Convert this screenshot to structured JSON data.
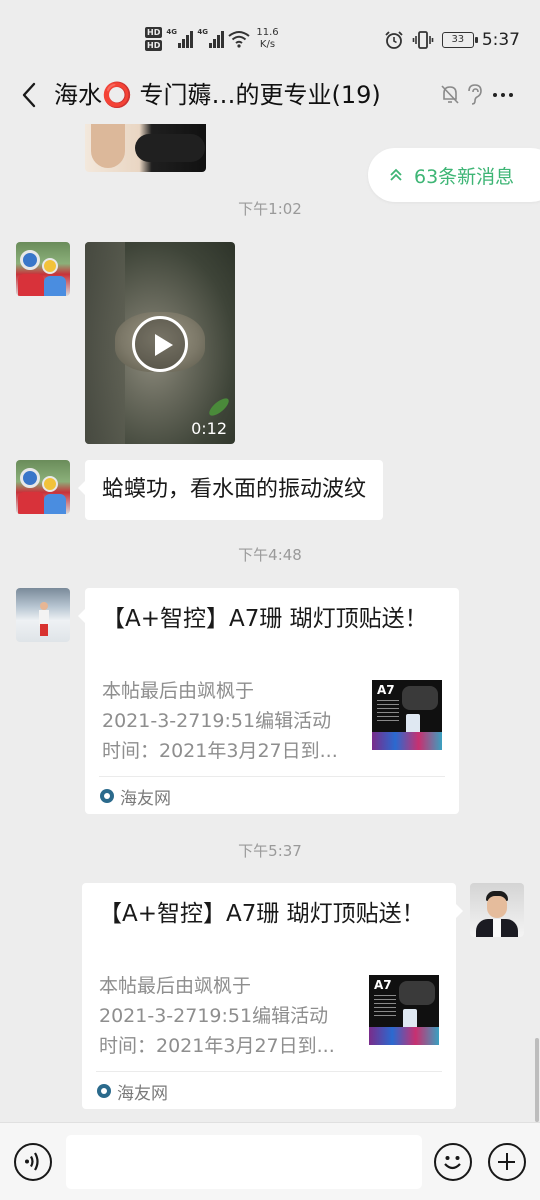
{
  "status_bar": {
    "hd_top": "HD",
    "hd_bottom": "HD",
    "net1": "4G",
    "net2": "4G",
    "speed_value": "11.6",
    "speed_unit": "K/s",
    "battery": "33",
    "time": "5:37"
  },
  "header": {
    "title": "海水⭕ 专门薅…的更专业(19)"
  },
  "new_messages": {
    "label": "63条新消息",
    "accent": "#3eb575"
  },
  "messages": {
    "ts1": "下午1:02",
    "video_duration": "0:12",
    "text1": "蛤蟆功，看水面的振动波纹",
    "ts2": "下午4:48",
    "card1": {
      "title": "【A+智控】A7珊 瑚灯顶贴送！",
      "desc1": "本帖最后由飒枫于",
      "desc2": "2021-3-2719:51编辑活动",
      "desc3": "时间：2021年3月27日到...",
      "thumb_label": "A7",
      "source": "海友网"
    },
    "ts3": "下午5:37",
    "card2": {
      "title": "【A+智控】A7珊 瑚灯顶贴送！",
      "desc1": "本帖最后由飒枫于",
      "desc2": "2021-3-2719:51编辑活动",
      "desc3": "时间：2021年3月27日到...",
      "thumb_label": "A7",
      "source": "海友网"
    }
  },
  "input": {
    "value": ""
  },
  "colors": {
    "background": "#ededed",
    "bubble": "#ffffff",
    "timestamp": "#9a9a9a"
  }
}
